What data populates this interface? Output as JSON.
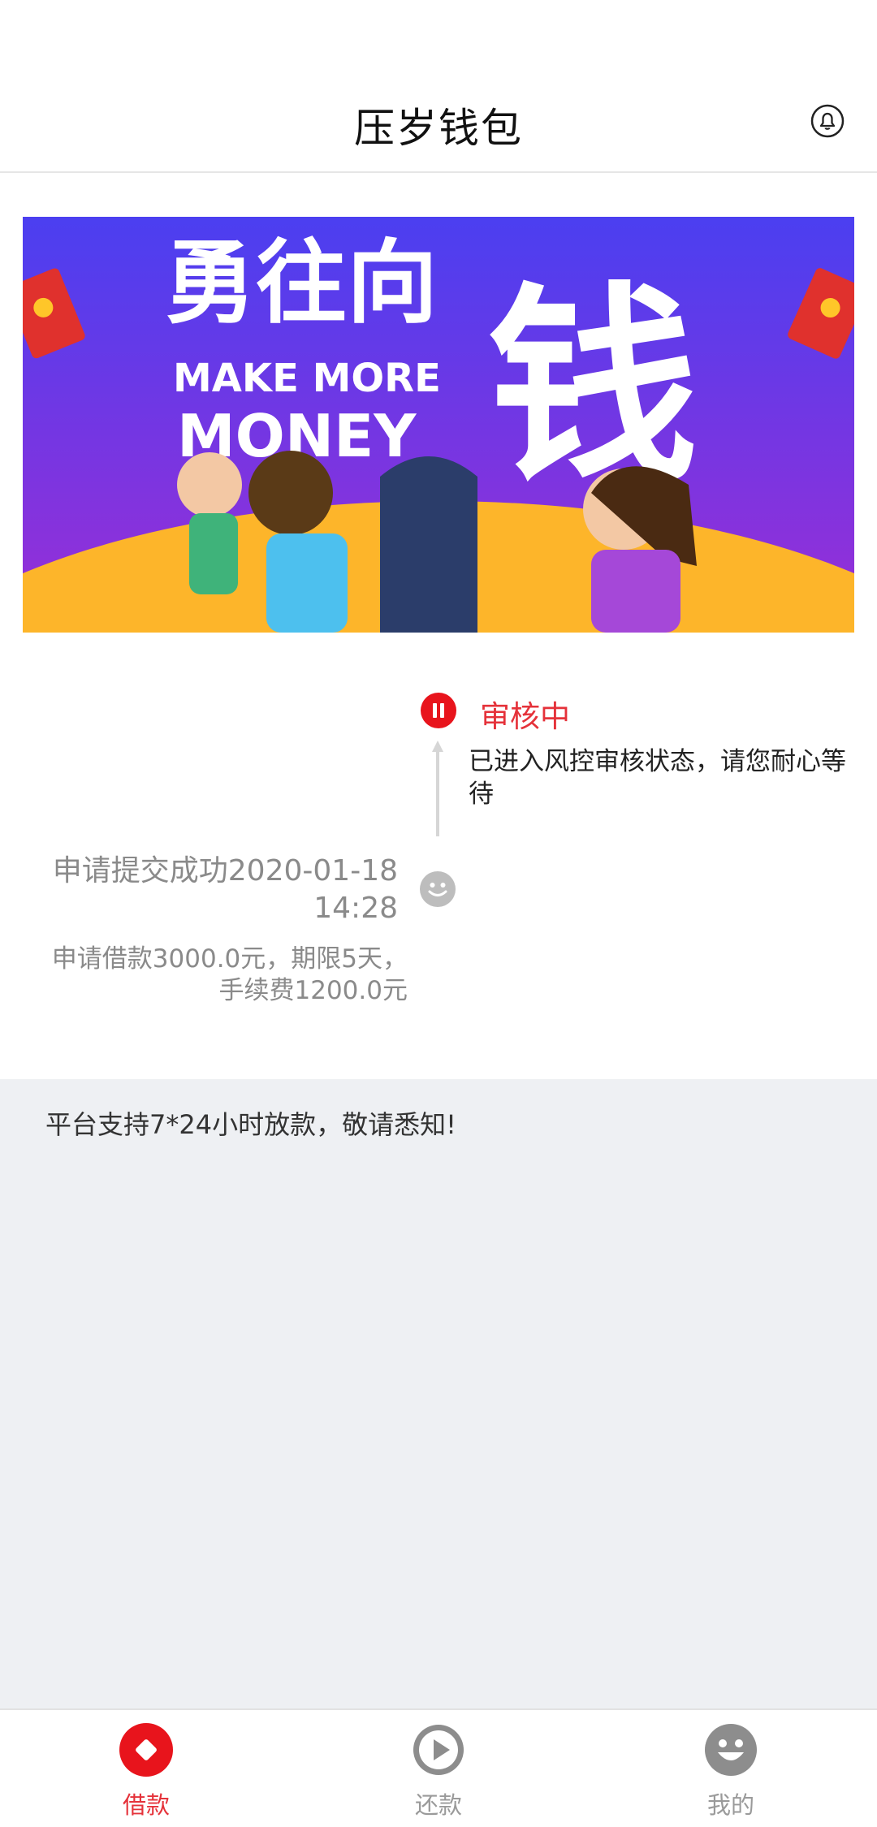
{
  "header": {
    "title": "压岁钱包",
    "bell_icon": "bell-icon"
  },
  "banner": {
    "headline_cn_left": "勇往向",
    "headline_cn_right": "钱",
    "headline_en_1": "MAKE MORE",
    "headline_en_2": "MONEY"
  },
  "timeline": {
    "current": {
      "icon": "pause-icon",
      "title": "审核中",
      "description": "已进入风控审核状态，请您耐心等待"
    },
    "submitted": {
      "icon": "smile-icon",
      "title_line1": "申请提交成功2020-01-18",
      "title_line2": "14:28",
      "desc_line1": "申请借款3000.0元，期限5天，",
      "desc_line2": "手续费1200.0元"
    }
  },
  "notice": "平台支持7*24小时放款，敬请悉知!",
  "tabs": [
    {
      "label": "借款",
      "icon": "diamond-icon",
      "active": true
    },
    {
      "label": "还款",
      "icon": "play-icon",
      "active": false
    },
    {
      "label": "我的",
      "icon": "smile-icon",
      "active": false
    }
  ],
  "colors": {
    "accent": "#e5323a",
    "banner_top": "#4b3ff0",
    "banner_bottom": "#9a2ed6",
    "banner_ground": "#fdb52a"
  }
}
